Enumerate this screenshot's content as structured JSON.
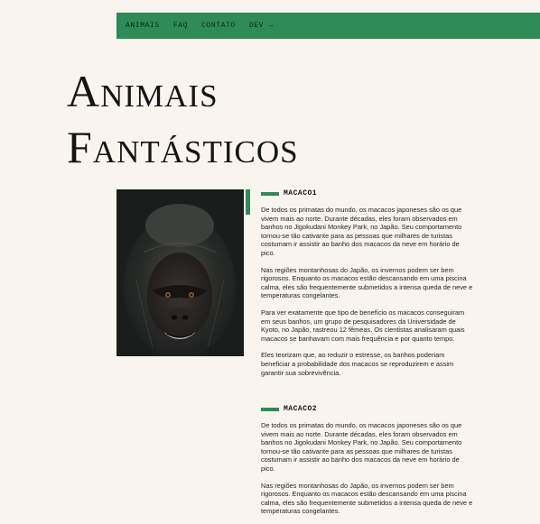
{
  "nav": {
    "items": [
      {
        "label": "ANIMAIS"
      },
      {
        "label": "FAQ"
      },
      {
        "label": "CONTATO"
      },
      {
        "label": "DEV →"
      }
    ]
  },
  "page": {
    "title_line1": "Animais",
    "title_line2": "Fantásticos"
  },
  "photo": {
    "subject": "gorilla-photo"
  },
  "sections": [
    {
      "title": "MACACO1",
      "paragraphs": [
        "De todos os primatas do mundo, os macacos japoneses são os que vivem mais ao norte. Durante décadas, eles foram observados em banhos no Jigokudani Monkey Park, no Japão. Seu comportamento tornou-se tão cativante para as pessoas que milhares de turistas costumam ir assistir ao banho dos macacos da neve em horário de pico.",
        "Nas regiões montanhosas do Japão, os invernos podem ser bem rigorosos. Enquanto os macacos estão descansando em uma piscina calma, eles são frequentemente submetidos a intensa queda de neve e temperaturas congelantes.",
        "Para ver exatamente que tipo de benefício os macacos conseguiram em seus banhos, um grupo de pesquisadores da Universidade de Kyoto, no Japão, rastreou 12 fêmeas. Os cientistas analisaram quais macacos se banhavam com mais frequência e por quanto tempo.",
        "Eles teorizam que, ao reduzir o estresse, os banhos poderiam beneficiar a probabilidade dos macacos se reproduzirem e assim garantir sua sobrevivência."
      ]
    },
    {
      "title": "MACACO2",
      "paragraphs": [
        "De todos os primatas do mundo, os macacos japoneses são os que vivem mais ao norte. Durante décadas, eles foram observados em banhos no Jigokudani Monkey Park, no Japão. Seu comportamento tornou-se tão cativante para as pessoas que milhares de turistas costumam ir assistir ao banho dos macacos da neve em horário de pico.",
        "Nas regiões montanhosas do Japão, os invernos podem ser bem rigorosos. Enquanto os macacos estão descansando em uma piscina calma, eles são frequentemente submetidos a intensa queda de neve e temperaturas congelantes."
      ]
    }
  ],
  "colors": {
    "accent": "#2e8b57",
    "background": "#f9f5ee",
    "text": "#222222"
  }
}
